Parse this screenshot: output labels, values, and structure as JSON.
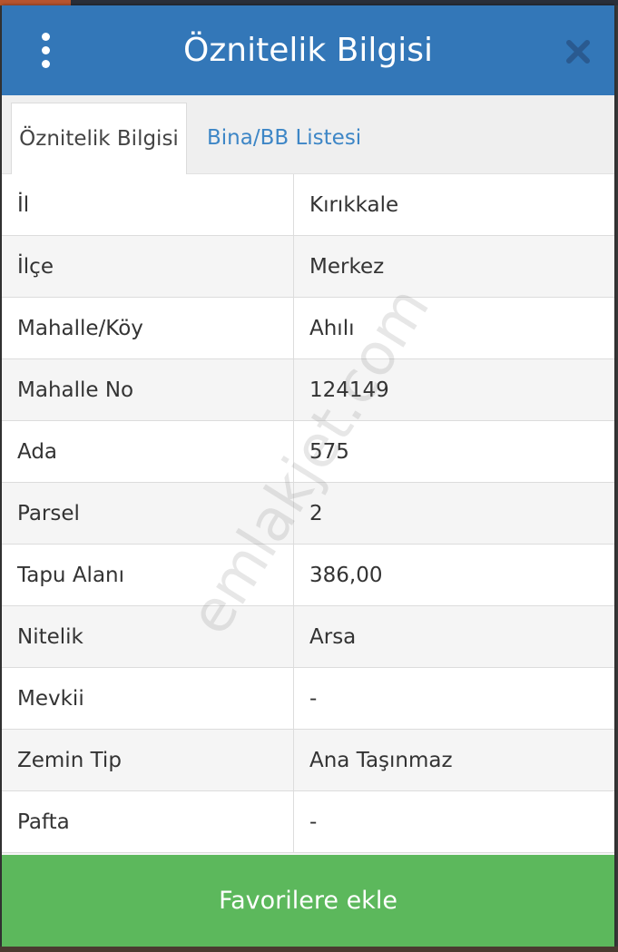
{
  "header": {
    "title": "Öznitelik Bilgisi",
    "menu_icon": "kebab-menu-icon",
    "close_icon": "close-icon"
  },
  "tabs": [
    {
      "label": "Öznitelik Bilgisi",
      "active": true
    },
    {
      "label": "Bina/BB Listesi",
      "active": false
    }
  ],
  "attributes": [
    {
      "key": "İl",
      "value": "Kırıkkale"
    },
    {
      "key": "İlçe",
      "value": "Merkez"
    },
    {
      "key": "Mahalle/Köy",
      "value": "Ahılı"
    },
    {
      "key": "Mahalle No",
      "value": "124149"
    },
    {
      "key": "Ada",
      "value": "575"
    },
    {
      "key": "Parsel",
      "value": "2"
    },
    {
      "key": "Tapu Alanı",
      "value": "386,00"
    },
    {
      "key": "Nitelik",
      "value": "Arsa"
    },
    {
      "key": "Mevkii",
      "value": "-"
    },
    {
      "key": "Zemin Tip",
      "value": "Ana Taşınmaz"
    },
    {
      "key": "Pafta",
      "value": "-"
    }
  ],
  "watermark": "emlakjet.com",
  "favorite_button": "Favorilere ekle",
  "colors": {
    "header": "#3377b8",
    "tab_link": "#3d86c6",
    "favorite_button": "#5cb85c"
  }
}
